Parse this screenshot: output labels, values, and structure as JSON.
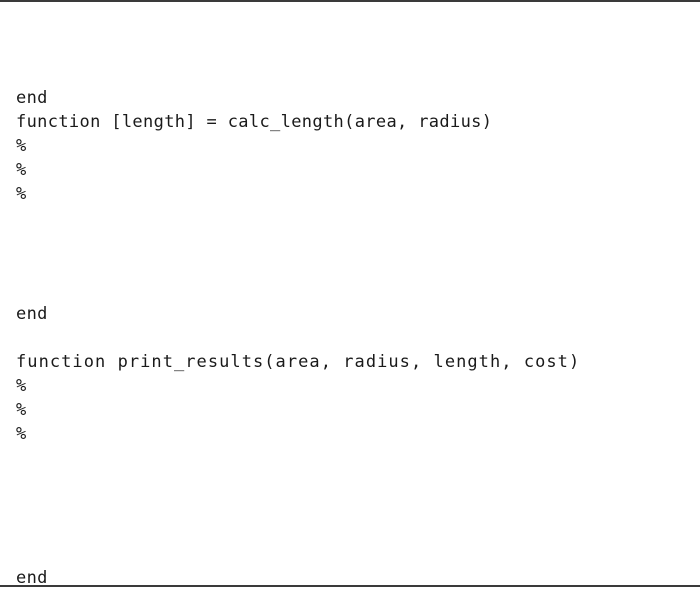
{
  "page": {
    "kind": "code-listing",
    "language": "MATLAB",
    "background_color": "#ffffff",
    "text_color": "#1a1a1a",
    "rule_color": "#3a3a3a"
  },
  "rules": {
    "top_label": "top-page-rule",
    "bottom_label": "bottom-page-rule"
  },
  "code": {
    "lines": [
      {
        "id": "l1",
        "text": "end"
      },
      {
        "id": "l2",
        "text": "function [length] = calc_length(area, radius)"
      },
      {
        "id": "l3",
        "text": "%"
      },
      {
        "id": "l4",
        "text": "%"
      },
      {
        "id": "l5",
        "text": "%"
      },
      {
        "id": "l6",
        "text": ""
      },
      {
        "id": "l7",
        "text": ""
      },
      {
        "id": "l8",
        "text": ""
      },
      {
        "id": "l9",
        "text": ""
      },
      {
        "id": "l10",
        "text": "end"
      },
      {
        "id": "l11",
        "text": ""
      },
      {
        "id": "l12",
        "text": "function print_results(area, radius, length, cost)"
      },
      {
        "id": "l13",
        "text": "%"
      },
      {
        "id": "l14",
        "text": "%"
      },
      {
        "id": "l15",
        "text": "%"
      },
      {
        "id": "l16",
        "text": ""
      },
      {
        "id": "l17",
        "text": ""
      },
      {
        "id": "l18",
        "text": ""
      },
      {
        "id": "l19",
        "text": ""
      },
      {
        "id": "l20",
        "text": ""
      },
      {
        "id": "l21",
        "text": "end"
      }
    ]
  }
}
